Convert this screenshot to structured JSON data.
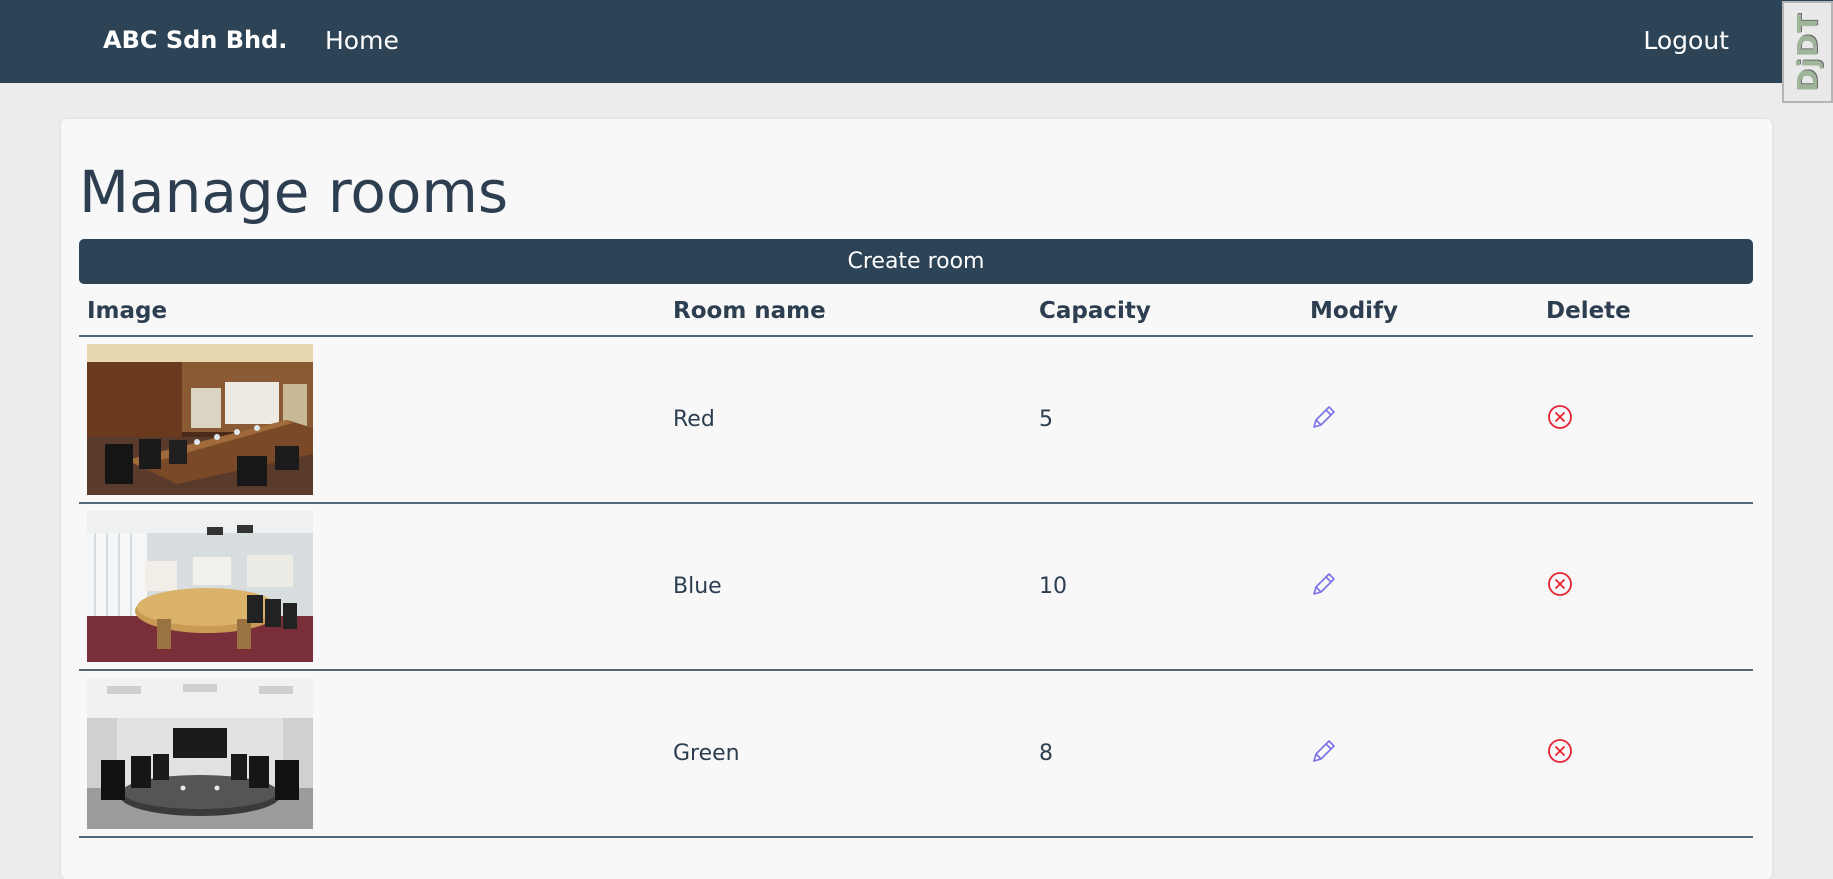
{
  "navbar": {
    "brand": "ABC Sdn Bhd.",
    "home": "Home",
    "logout": "Logout",
    "toolbar_badge": "DjDT"
  },
  "page": {
    "title": "Manage rooms",
    "create_button": "Create room"
  },
  "table": {
    "headers": {
      "image": "Image",
      "room_name": "Room name",
      "capacity": "Capacity",
      "modify": "Modify",
      "delete": "Delete"
    },
    "rows": [
      {
        "name": "Red",
        "capacity": "5",
        "image": "conference-room-photo"
      },
      {
        "name": "Blue",
        "capacity": "10",
        "image": "conference-room-photo"
      },
      {
        "name": "Green",
        "capacity": "8",
        "image": "conference-room-photo"
      }
    ]
  },
  "icons": {
    "modify": "pencil-icon",
    "delete": "circle-x-icon"
  },
  "colors": {
    "navbar": "#2d4356",
    "text": "#2c3e50",
    "modify_icon": "#7b72e9",
    "delete_icon": "#e8212e"
  }
}
